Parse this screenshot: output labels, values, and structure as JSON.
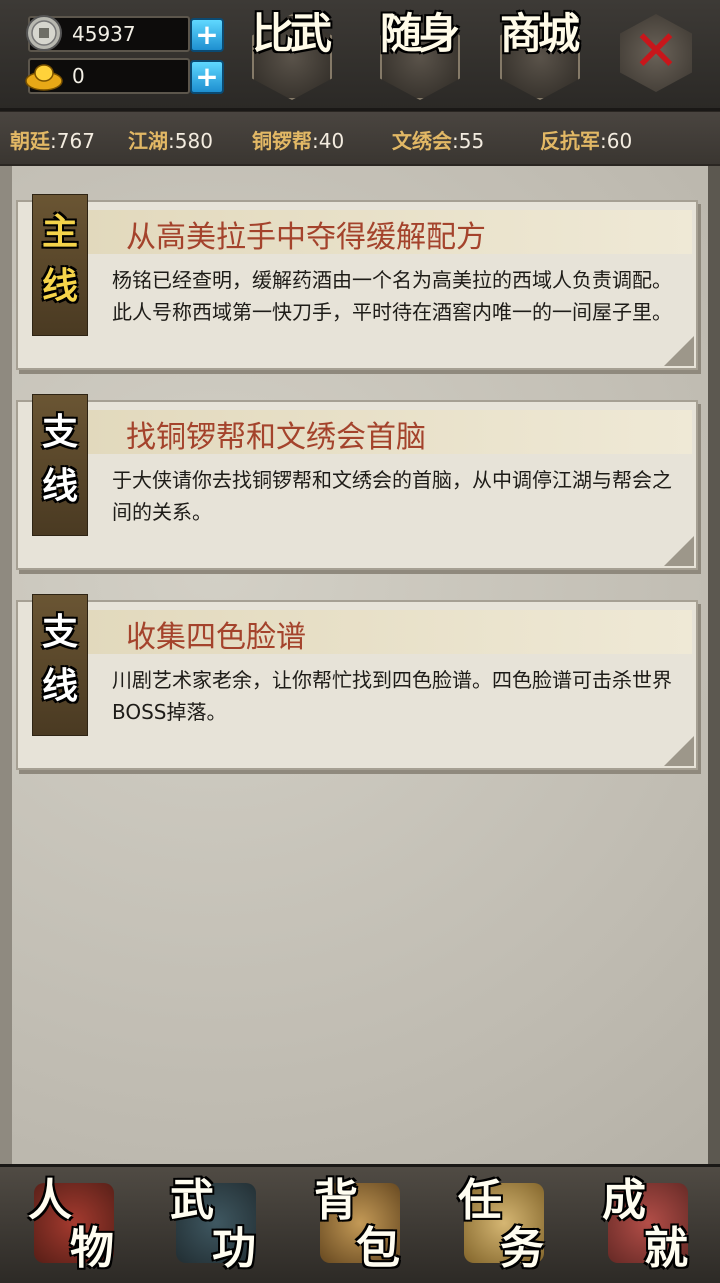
{
  "currency": {
    "coins": "45937",
    "gold": "0"
  },
  "top_menu": {
    "arena": "比武",
    "carry": "随身",
    "shop": "商城"
  },
  "reputation": [
    {
      "name": "朝廷",
      "value": ":767"
    },
    {
      "name": "江湖",
      "value": ":580"
    },
    {
      "name": "铜锣帮",
      "value": ":40"
    },
    {
      "name": "文绣会",
      "value": ":55"
    },
    {
      "name": "反抗军",
      "value": ":60"
    }
  ],
  "quests": [
    {
      "tag_top": "主",
      "tag_bottom": "线",
      "title": "从高美拉手中夺得缓解配方",
      "desc": "杨铭已经查明，缓解药酒由一个名为高美拉的西域人负责调配。此人号称西域第一快刀手，平时待在酒窖内唯一的一间屋子里。"
    },
    {
      "tag_top": "支",
      "tag_bottom": "线",
      "title": "找铜锣帮和文绣会首脑",
      "desc": "于大侠请你去找铜锣帮和文绣会的首脑，从中调停江湖与帮会之间的关系。"
    },
    {
      "tag_top": "支",
      "tag_bottom": "线",
      "title": "收集四色脸谱",
      "desc": "川剧艺术家老余，让你帮忙找到四色脸谱。四色脸谱可击杀世界BOSS掉落。"
    }
  ],
  "bottom_nav": [
    {
      "c1": "人",
      "c2": "物"
    },
    {
      "c1": "武",
      "c2": "功"
    },
    {
      "c1": "背",
      "c2": "包"
    },
    {
      "c1": "任",
      "c2": "务"
    },
    {
      "c1": "成",
      "c2": "就"
    }
  ],
  "colors": {
    "main_tag_text": "#f5d44a",
    "side_tag_text": "#ffffff",
    "quest_title": "#a4432c",
    "close_x": "#c8161b"
  },
  "icons": {
    "coin": "coin-icon",
    "gold": "gold-ingot-icon",
    "add": "plus-icon",
    "close": "close-icon"
  }
}
